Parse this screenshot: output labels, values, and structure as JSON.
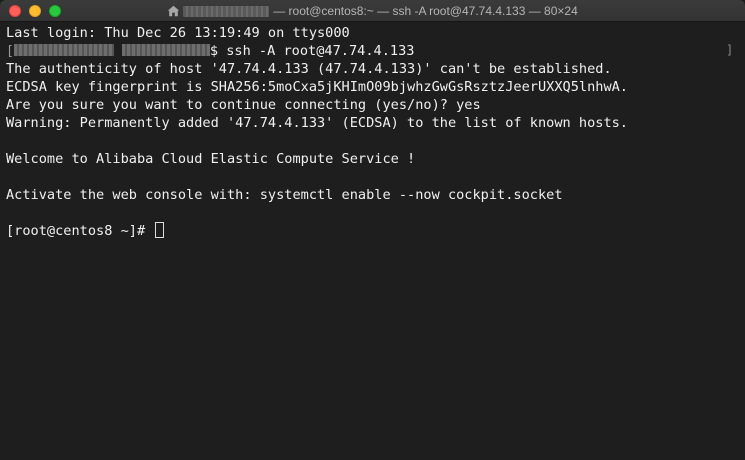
{
  "window": {
    "title_suffix": "— root@centos8:~ — ssh -A root@47.74.4.133 — 80×24"
  },
  "terminal": {
    "lines": [
      "Last login: Thu Dec 26 13:19:49 on ttys000",
      "$ ssh -A root@47.74.4.133",
      "The authenticity of host '47.74.4.133 (47.74.4.133)' can't be established.",
      "ECDSA key fingerprint is SHA256:5moCxa5jKHImO09bjwhzGwGsRsztzJeerUXXQ5lnhwA.",
      "Are you sure you want to continue connecting (yes/no)? yes",
      "Warning: Permanently added '47.74.4.133' (ECDSA) to the list of known hosts.",
      "",
      "Welcome to Alibaba Cloud Elastic Compute Service !",
      "",
      "Activate the web console with: systemctl enable --now cockpit.socket",
      "",
      "[root@centos8 ~]# "
    ]
  },
  "colors": {
    "background": "#1e1e1e",
    "text": "#f0f0f0",
    "close": "#fe5f57",
    "minimize": "#febc2e",
    "maximize": "#28c840"
  }
}
